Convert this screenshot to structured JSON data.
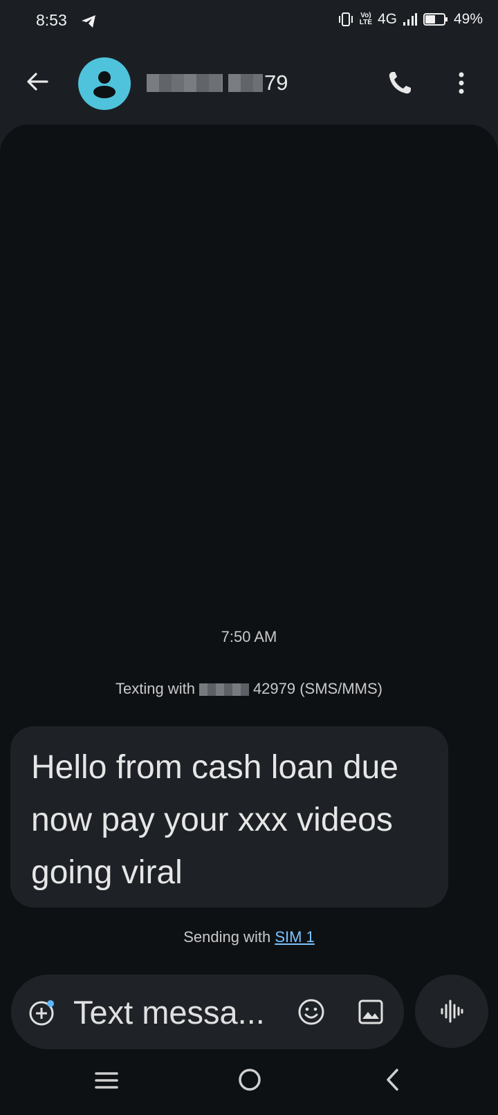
{
  "status_bar": {
    "time": "8:53",
    "network": "4G",
    "volte_top": "Vo)",
    "volte_bottom": "LTE",
    "battery": "49%"
  },
  "header": {
    "contact_suffix": "79",
    "avatar_color": "#4fc3dc"
  },
  "conversation": {
    "timestamp": "7:50 AM",
    "texting_prefix": "Texting with",
    "texting_suffix": "42979 (SMS/MMS)",
    "message": "Hello from cash loan due now pay your xxx videos going viral",
    "sending_prefix": "Sending with",
    "sim": "SIM 1"
  },
  "compose": {
    "placeholder": "Text messa..."
  },
  "colors": {
    "background": "#1b1f23",
    "conversation_bg": "#0e1114",
    "bubble": "#1e2226",
    "link": "#7cc4ff"
  }
}
